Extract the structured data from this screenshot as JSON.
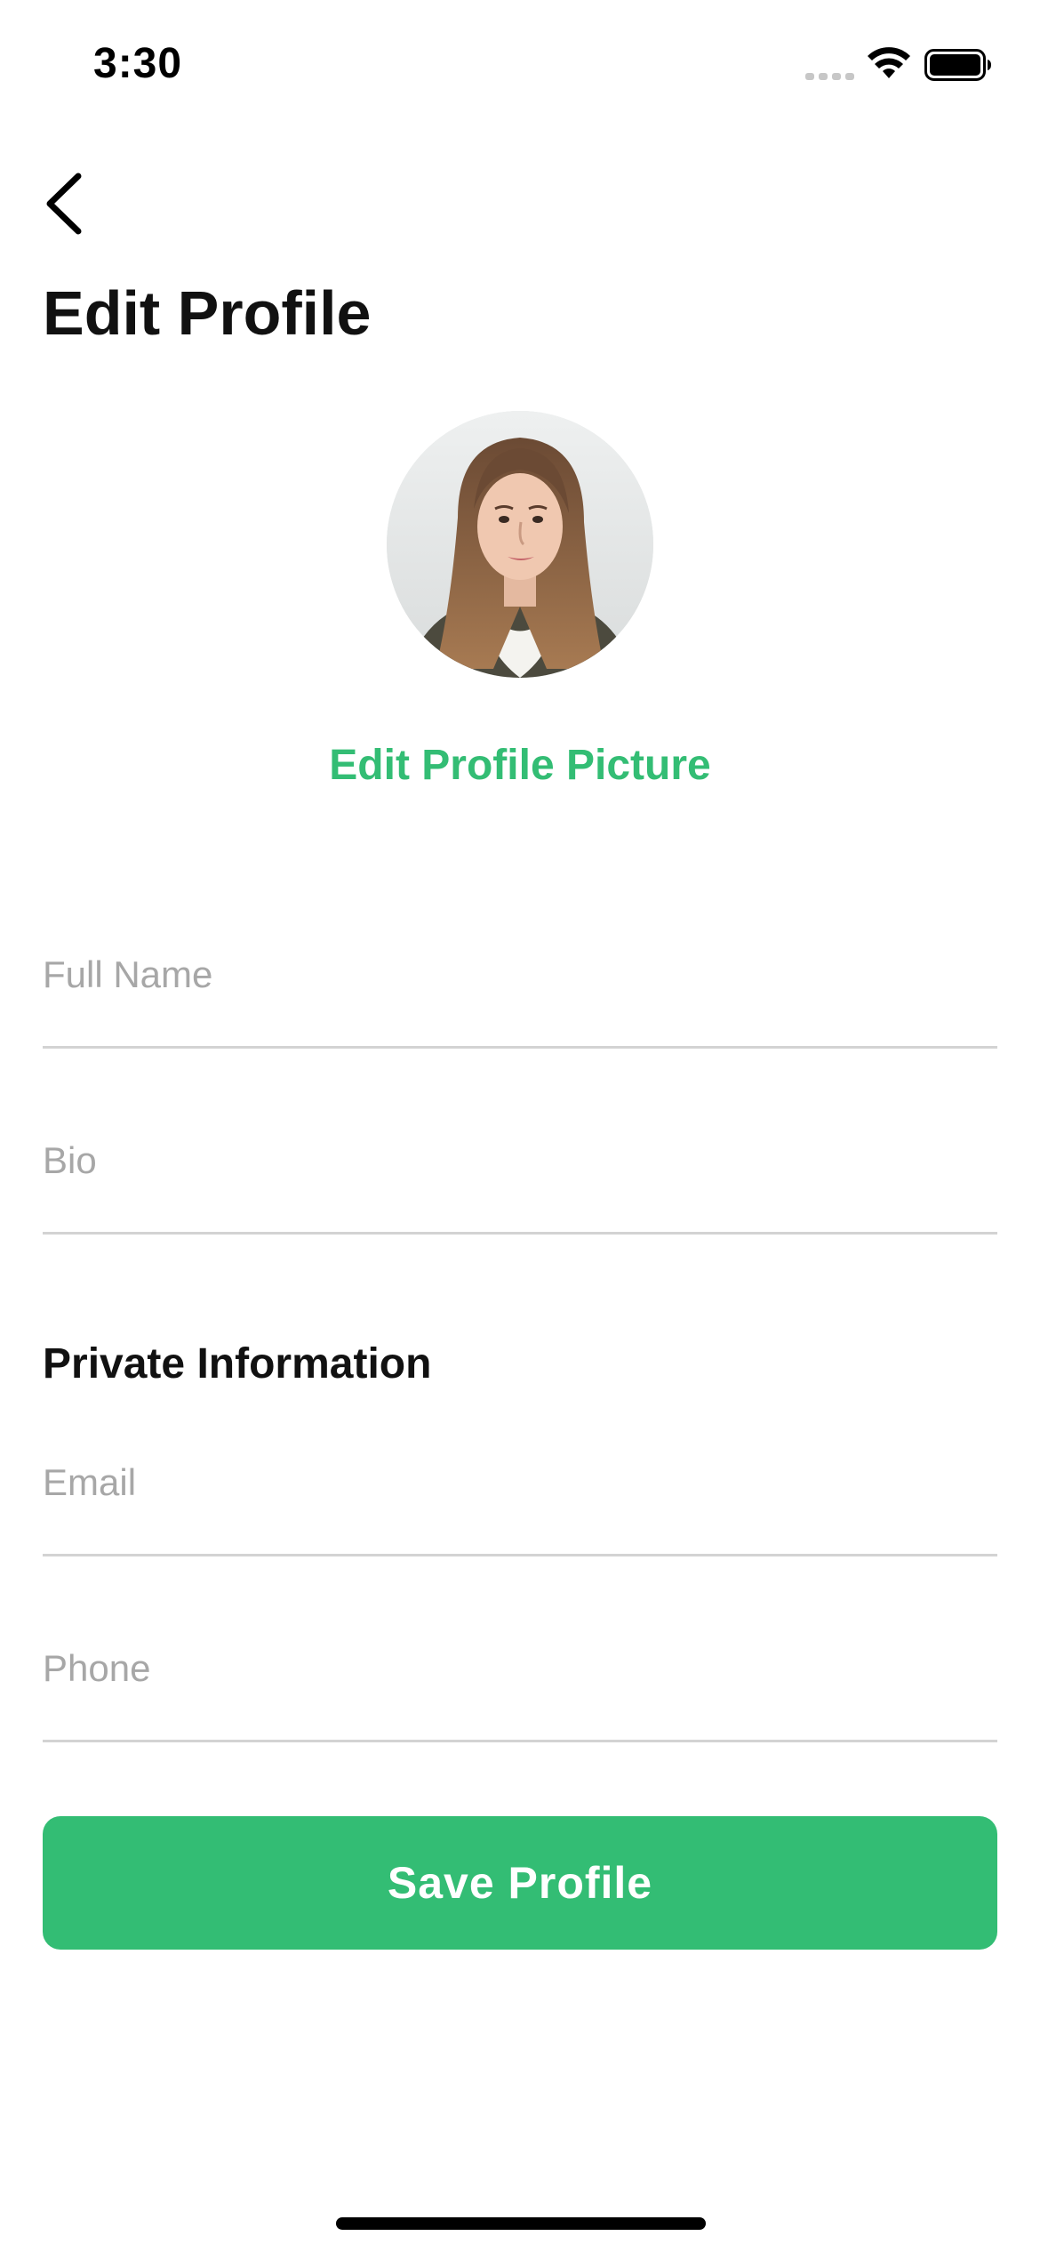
{
  "status_bar": {
    "time": "3:30",
    "icons": [
      "signal-icon",
      "wifi-icon",
      "battery-icon"
    ]
  },
  "header": {
    "back_icon": "chevron-left-icon",
    "title": "Edit Profile"
  },
  "profile": {
    "avatar": "avatar",
    "edit_picture_label": "Edit Profile Picture"
  },
  "form": {
    "full_name": {
      "placeholder": "Full Name",
      "value": ""
    },
    "bio": {
      "placeholder": "Bio",
      "value": ""
    },
    "private_section_title": "Private Information",
    "email": {
      "placeholder": "Email",
      "value": ""
    },
    "phone": {
      "placeholder": "Phone",
      "value": ""
    }
  },
  "actions": {
    "save_label": "Save Profile"
  },
  "colors": {
    "accent": "#33bd74",
    "placeholder": "#a7a7a7",
    "divider": "#d3d3d3",
    "text": "#111111"
  }
}
